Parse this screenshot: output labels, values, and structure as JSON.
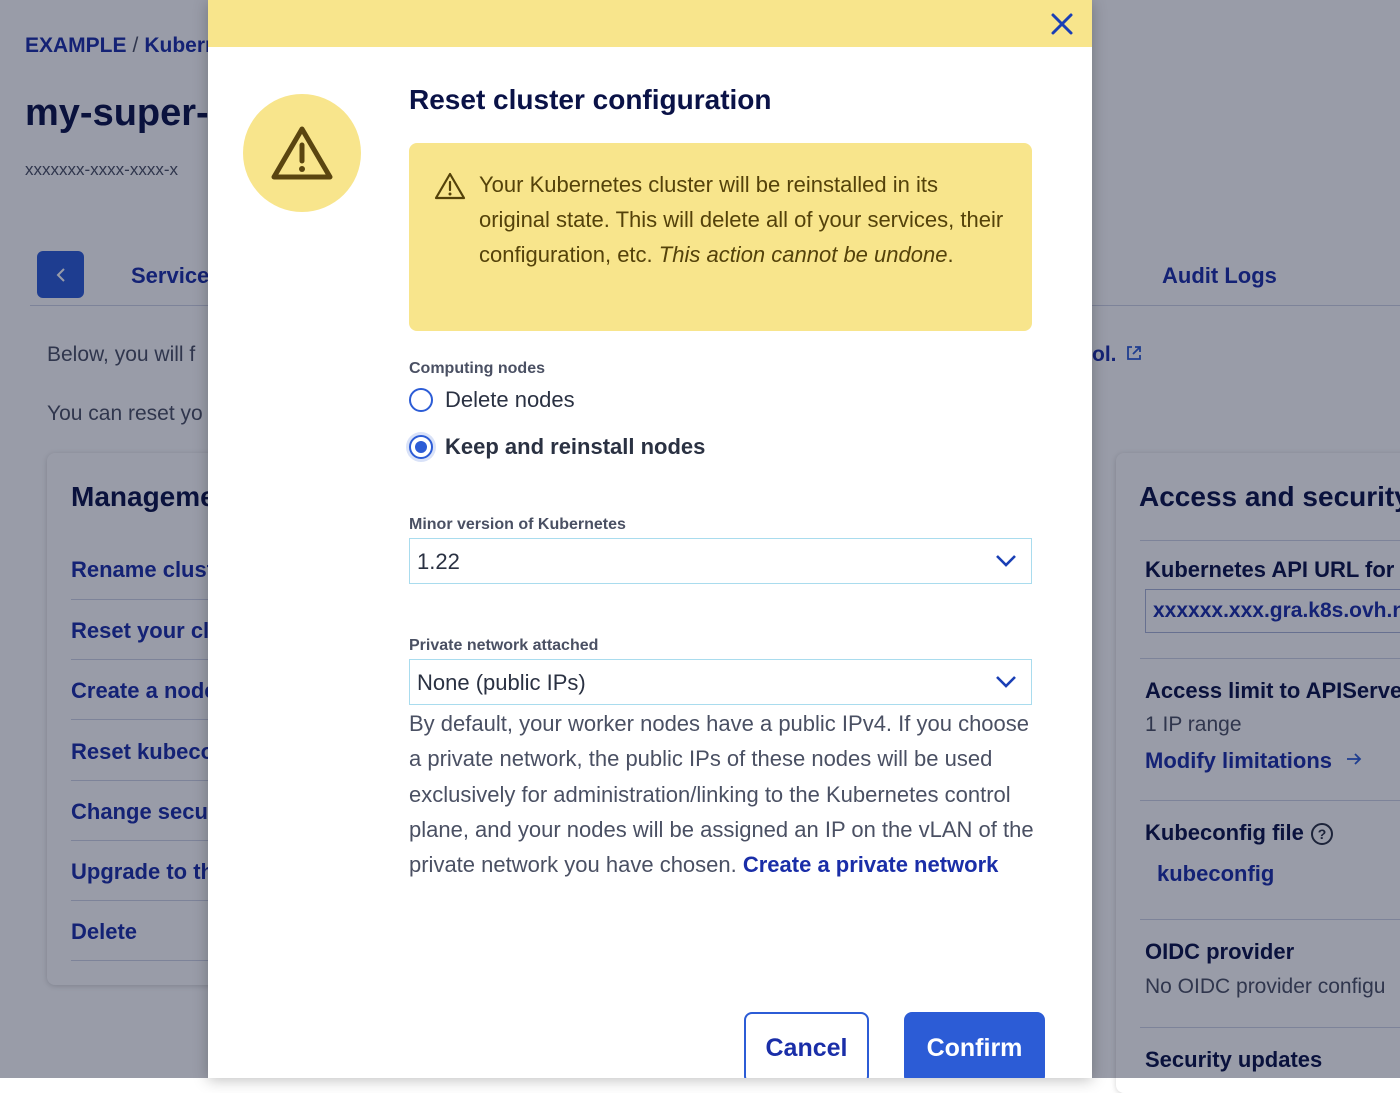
{
  "background": {
    "breadcrumb": [
      "EXAMPLE",
      "/",
      "Kuberr"
    ],
    "cluster_title": "my-super-",
    "cluster_id": "xxxxxxx-xxxx-xxxx-x",
    "tabs": {
      "services": "Service",
      "audit_logs": "Audit Logs"
    },
    "paragraph1_start": "Below, you will f",
    "paragraph1_link": "ol.",
    "paragraph2": "You can reset yo",
    "management": {
      "title": "Manageme",
      "items": [
        "Rename clust",
        "Reset your clu",
        "Create a node",
        "Reset kubeco",
        "Change secur",
        "Upgrade to th",
        "Delete"
      ]
    },
    "access": {
      "title": "Access and security",
      "api_url_label": "Kubernetes API URL for y",
      "api_url_value": "xxxxxx.xxx.gra.k8s.ovh.n",
      "limit_label": "Access limit to APIServer",
      "limit_value": "1 IP range",
      "modify_link": "Modify limitations",
      "kubeconfig_label": "Kubeconfig file",
      "kubeconfig_link": "kubeconfig",
      "oidc_label": "OIDC provider",
      "oidc_value": "No OIDC provider configu",
      "security_label": "Security updates"
    }
  },
  "modal": {
    "title": "Reset cluster configuration",
    "warning": {
      "text_plain": "Your Kubernetes cluster will be reinstalled in its original state. This will delete all of your services, their configuration, etc. ",
      "text_emphasis": "This action cannot be undone",
      "text_end": "."
    },
    "computing_nodes": {
      "label": "Computing nodes",
      "options": [
        {
          "label": "Delete nodes",
          "checked": false
        },
        {
          "label": "Keep and reinstall nodes",
          "checked": true
        }
      ]
    },
    "minor_version": {
      "label": "Minor version of Kubernetes",
      "value": "1.22"
    },
    "private_network": {
      "label": "Private network attached",
      "value": "None (public IPs)",
      "help": "By default, your worker nodes have a public IPv4. If you choose a private network, the public IPs of these nodes will be used exclusively for administration/linking to the Kubernetes control plane, and your nodes will be assigned an IP on the vLAN of the private network you have chosen. ",
      "help_link": "Create a private network"
    },
    "buttons": {
      "cancel": "Cancel",
      "confirm": "Confirm"
    }
  },
  "colors": {
    "primary": "#2c5cd6",
    "warning_bg": "#f8e58c",
    "heading": "#0a1247",
    "link": "#1a2ea8"
  },
  "icons": [
    "chevron-left-icon",
    "external-link-icon",
    "arrow-right-icon",
    "help-circle-icon",
    "close-icon",
    "warning-icon",
    "chevron-down-icon"
  ]
}
